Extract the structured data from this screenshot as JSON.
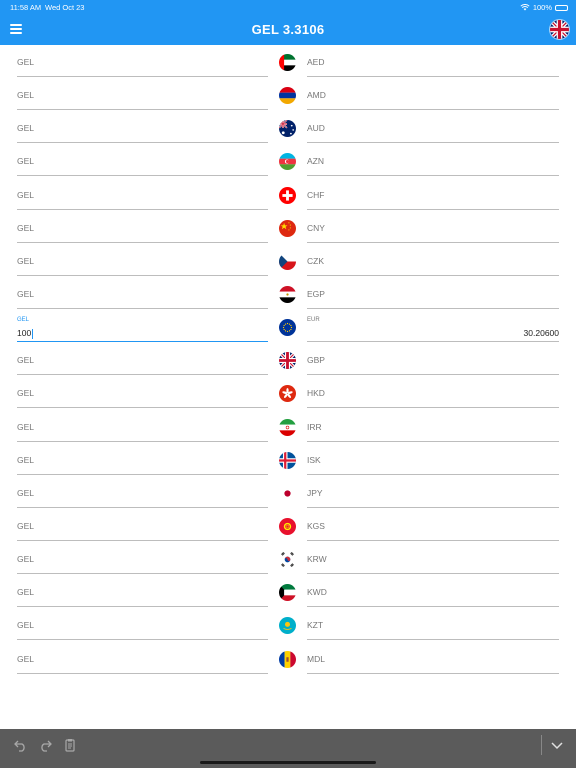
{
  "status_bar": {
    "time": "11:58 AM",
    "date": "Wed Oct 23",
    "battery": "100%"
  },
  "header": {
    "title": "GEL  3.3106",
    "menu_icon": "hamburger-menu-icon",
    "flag_icon": "uk-flag-icon"
  },
  "rows": [
    {
      "left": "GEL",
      "right": "AED",
      "flag": "uae-flag"
    },
    {
      "left": "GEL",
      "right": "AMD",
      "flag": "armenia-flag"
    },
    {
      "left": "GEL",
      "right": "AUD",
      "flag": "australia-flag"
    },
    {
      "left": "GEL",
      "right": "AZN",
      "flag": "azerbaijan-flag"
    },
    {
      "left": "GEL",
      "right": "CHF",
      "flag": "switzerland-flag"
    },
    {
      "left": "GEL",
      "right": "CNY",
      "flag": "china-flag"
    },
    {
      "left": "GEL",
      "right": "CZK",
      "flag": "czech-flag"
    },
    {
      "left": "GEL",
      "right": "EGP",
      "flag": "egypt-flag"
    },
    {
      "left": "GEL",
      "right": "EUR",
      "flag": "eu-flag",
      "active": true,
      "left_value": "100",
      "right_value": "30.20600"
    },
    {
      "left": "GEL",
      "right": "GBP",
      "flag": "uk-flag"
    },
    {
      "left": "GEL",
      "right": "HKD",
      "flag": "hongkong-flag"
    },
    {
      "left": "GEL",
      "right": "IRR",
      "flag": "iran-flag"
    },
    {
      "left": "GEL",
      "right": "ISK",
      "flag": "iceland-flag"
    },
    {
      "left": "GEL",
      "right": "JPY",
      "flag": "japan-flag"
    },
    {
      "left": "GEL",
      "right": "KGS",
      "flag": "kyrgyzstan-flag"
    },
    {
      "left": "GEL",
      "right": "KRW",
      "flag": "korea-flag"
    },
    {
      "left": "GEL",
      "right": "KWD",
      "flag": "kuwait-flag"
    },
    {
      "left": "GEL",
      "right": "KZT",
      "flag": "kazakhstan-flag"
    },
    {
      "left": "GEL",
      "right": "MDL",
      "flag": "moldova-flag"
    }
  ],
  "keyboard_toolbar": {
    "undo_icon": "undo-icon",
    "redo_icon": "redo-icon",
    "paste_icon": "paste-icon",
    "dismiss_icon": "chevron-down-icon"
  },
  "colors": {
    "accent": "#2196F3",
    "toolbar": "#5b5b5b"
  }
}
